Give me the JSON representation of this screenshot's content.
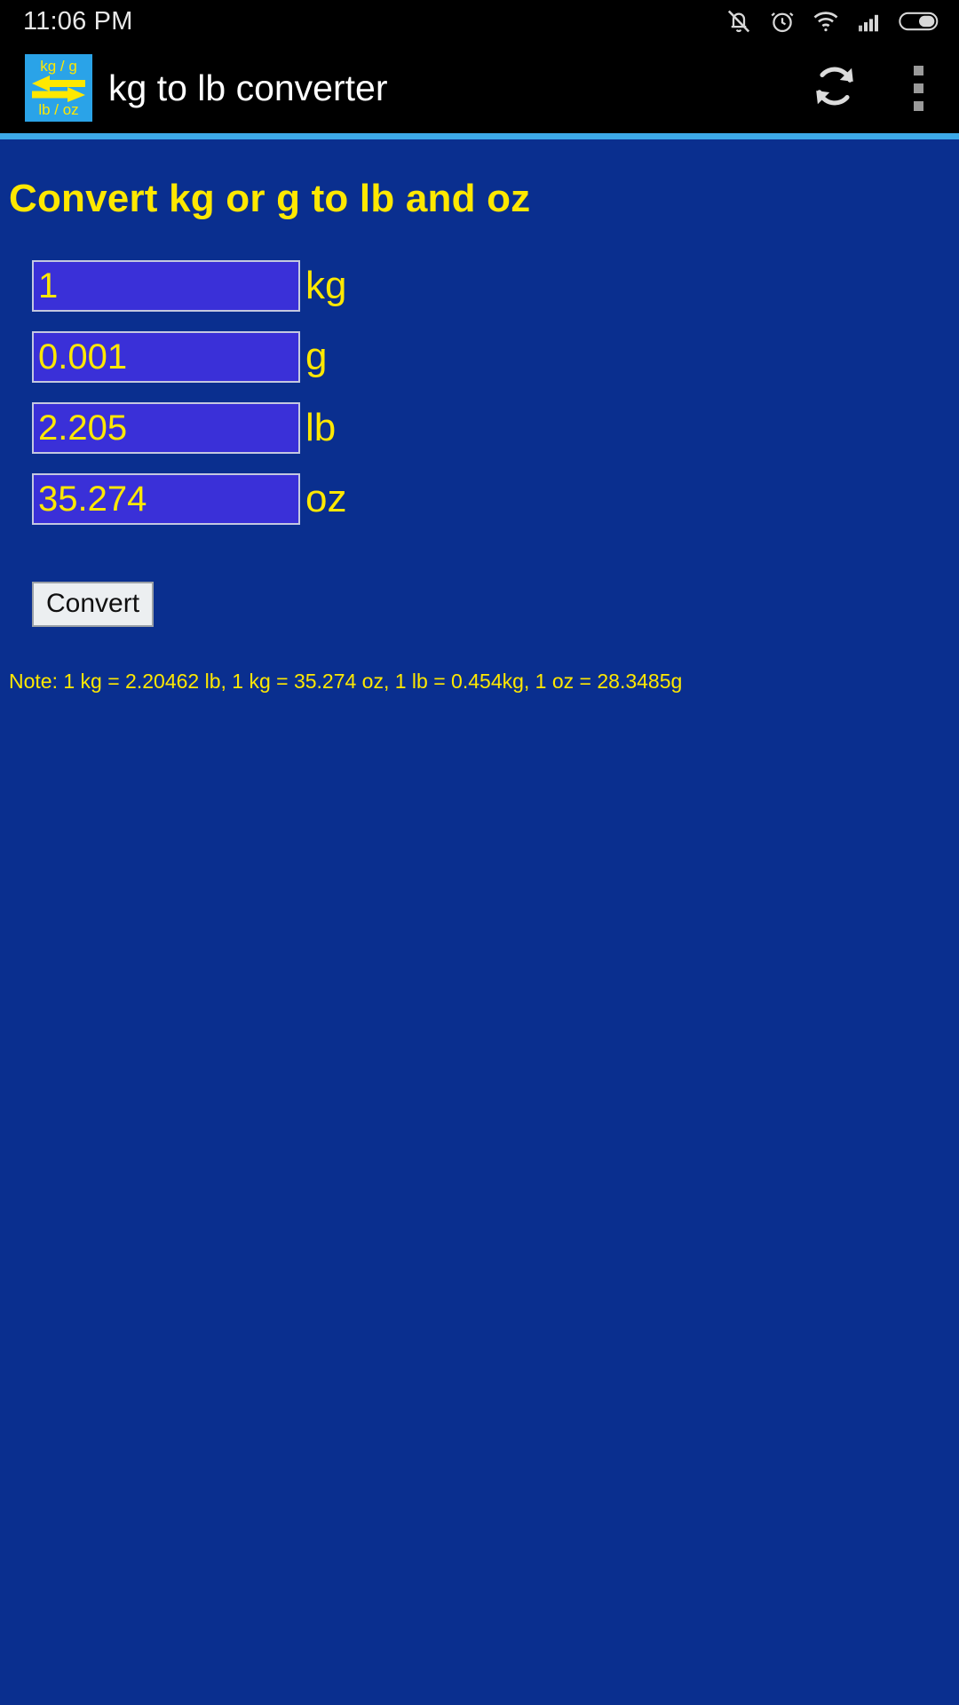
{
  "status_bar": {
    "clock": "11:06 PM",
    "icons": [
      "mute-bell-icon",
      "alarm-clock-icon",
      "wifi-icon",
      "cellular-signal-icon",
      "battery-icon"
    ]
  },
  "app_bar": {
    "title": "kg to lb converter",
    "icon": {
      "name": "app-logo-icon",
      "top_label": "kg / g",
      "bottom_label": "lb / oz",
      "background": "#2aa3e8",
      "foreground": "#ffe800"
    },
    "actions": [
      {
        "name": "refresh-icon",
        "label": "Refresh"
      },
      {
        "name": "overflow-menu-icon",
        "label": "More options"
      }
    ],
    "background": "#000000",
    "divider_color": "#3da9e8"
  },
  "main": {
    "heading": "Convert kg or g to lb and oz",
    "fields": [
      {
        "name": "kg",
        "value": "1",
        "unit": "kg"
      },
      {
        "name": "g",
        "value": "0.001",
        "unit": "g"
      },
      {
        "name": "lb",
        "value": "2.205",
        "unit": "lb"
      },
      {
        "name": "oz",
        "value": "35.274",
        "unit": "oz"
      }
    ],
    "convert_button": "Convert",
    "note": "Note: 1 kg = 2.20462 lb, 1 kg = 35.274 oz, 1 lb = 0.454kg, 1 oz = 28.3485g",
    "colors": {
      "background": "#0a2f8f",
      "accent_text": "#ffe800",
      "input_fill": "#3a30d8",
      "input_border": "#c4c8e0"
    }
  }
}
